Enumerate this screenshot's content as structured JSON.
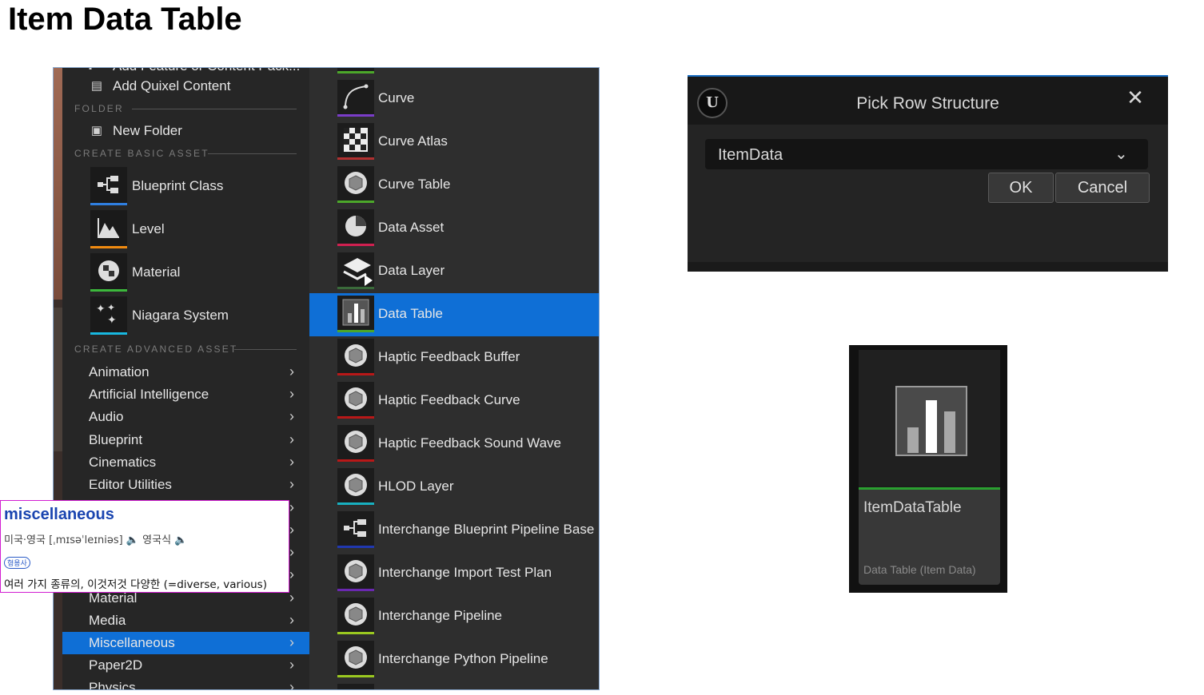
{
  "page": {
    "title": "Item Data Table"
  },
  "menu": {
    "top_items": [
      {
        "label": "Add Feature or Content Pack...",
        "icon": "add-icon"
      },
      {
        "label": "Add Quixel Content",
        "icon": "quixel-icon"
      }
    ],
    "folder_section": "FOLDER",
    "new_folder": "New Folder",
    "basic_section": "CREATE BASIC ASSET",
    "basic_assets": [
      {
        "label": "Blueprint Class",
        "icon": "blueprint-icon",
        "color": "#2f7fe0"
      },
      {
        "label": "Level",
        "icon": "level-icon",
        "color": "#f08a10"
      },
      {
        "label": "Material",
        "icon": "material-icon",
        "color": "#3cb83c"
      },
      {
        "label": "Niagara System",
        "icon": "niagara-icon",
        "color": "#18b8e0"
      }
    ],
    "advanced_section": "CREATE ADVANCED ASSET",
    "categories": [
      {
        "label": "Animation"
      },
      {
        "label": "Artificial Intelligence"
      },
      {
        "label": "Audio"
      },
      {
        "label": "Blueprint"
      },
      {
        "label": "Cinematics"
      },
      {
        "label": "Editor Utilities"
      },
      {
        "label": ""
      },
      {
        "label": ""
      },
      {
        "label": ""
      },
      {
        "label": ""
      },
      {
        "label": "Material"
      },
      {
        "label": "Media"
      },
      {
        "label": "Miscellaneous",
        "selected": true
      },
      {
        "label": "Paper2D"
      },
      {
        "label": "Physics"
      }
    ],
    "submenu": [
      {
        "label": "Curve",
        "icon": "curve-icon",
        "color": "#7a3cc8"
      },
      {
        "label": "Curve Atlas",
        "icon": "curve-atlas-icon",
        "color": "#b03030"
      },
      {
        "label": "Curve Table",
        "icon": "curve-table-icon",
        "color": "#4ca82a"
      },
      {
        "label": "Data Asset",
        "icon": "data-asset-icon",
        "color": "#d02050"
      },
      {
        "label": "Data Layer",
        "icon": "data-layer-icon",
        "color": "#3a6a3a"
      },
      {
        "label": "Data Table",
        "icon": "data-table-icon",
        "color": "#4ca82a",
        "selected": true
      },
      {
        "label": "Haptic Feedback Buffer",
        "icon": "haptic-icon",
        "color": "#b81818"
      },
      {
        "label": "Haptic Feedback Curve",
        "icon": "haptic-icon",
        "color": "#b81818"
      },
      {
        "label": "Haptic Feedback Sound Wave",
        "icon": "haptic-icon",
        "color": "#b81818"
      },
      {
        "label": "HLOD Layer",
        "icon": "hlod-icon",
        "color": "#18b0c0"
      },
      {
        "label": "Interchange Blueprint Pipeline Base",
        "icon": "interchange-blueprint-icon",
        "color": "#2038b0"
      },
      {
        "label": "Interchange Import Test Plan",
        "icon": "interchange-icon",
        "color": "#6a28b0"
      },
      {
        "label": "Interchange Pipeline",
        "icon": "interchange-icon",
        "color": "#9ac820"
      },
      {
        "label": "Interchange Python Pipeline",
        "icon": "interchange-icon",
        "color": "#9ac820"
      }
    ]
  },
  "dictionary": {
    "word": "miscellaneous",
    "pronunciation": "미국·영국 [ˌmɪsəˈleɪniəs] 🔈 영국식 🔈",
    "part_of_speech": "형용사",
    "definition": "여러 가지 종류의, 이것저것 다양한 (=diverse, various)"
  },
  "dialog": {
    "title": "Pick Row Structure",
    "selected_value": "ItemData",
    "ok_label": "OK",
    "cancel_label": "Cancel",
    "logo_text": "U"
  },
  "asset": {
    "name": "ItemDataTable",
    "type": "Data Table (Item Data)",
    "accent": "#2aa030"
  }
}
